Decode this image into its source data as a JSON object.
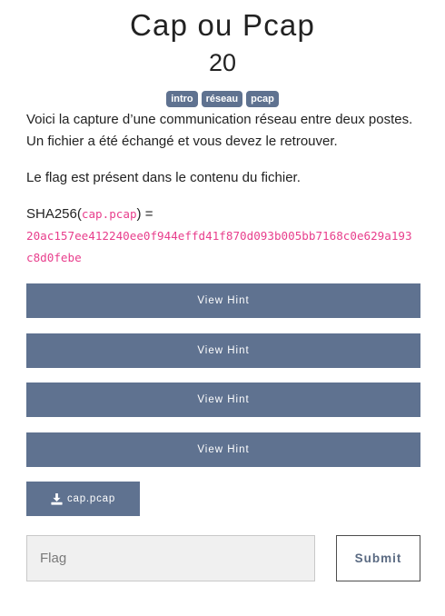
{
  "challenge": {
    "title": "Cap ou Pcap",
    "points": "20",
    "tags": [
      "intro",
      "réseau",
      "pcap"
    ],
    "description": {
      "paragraph1": "Voici la capture d’une communication réseau entre deux postes. Un fichier a été échangé et vous devez le retrouver.",
      "paragraph2": "Le flag est présent dans le contenu du fichier.",
      "hash_prefix": "SHA256(",
      "hash_filename": "cap.pcap",
      "hash_suffix": ") =",
      "hash_value": "20ac157ee412240ee0f944effd41f870d093b005bb7168c0e629a193c8d0febe"
    }
  },
  "hints": [
    {
      "label": "View Hint"
    },
    {
      "label": "View Hint"
    },
    {
      "label": "View Hint"
    },
    {
      "label": "View Hint"
    }
  ],
  "download": {
    "label": "cap.pcap",
    "icon": "download-icon"
  },
  "flag_form": {
    "placeholder": "Flag",
    "value": "",
    "submit_label": "Submit"
  },
  "colors": {
    "accent": "#5f7290",
    "code": "#e83e8c"
  }
}
